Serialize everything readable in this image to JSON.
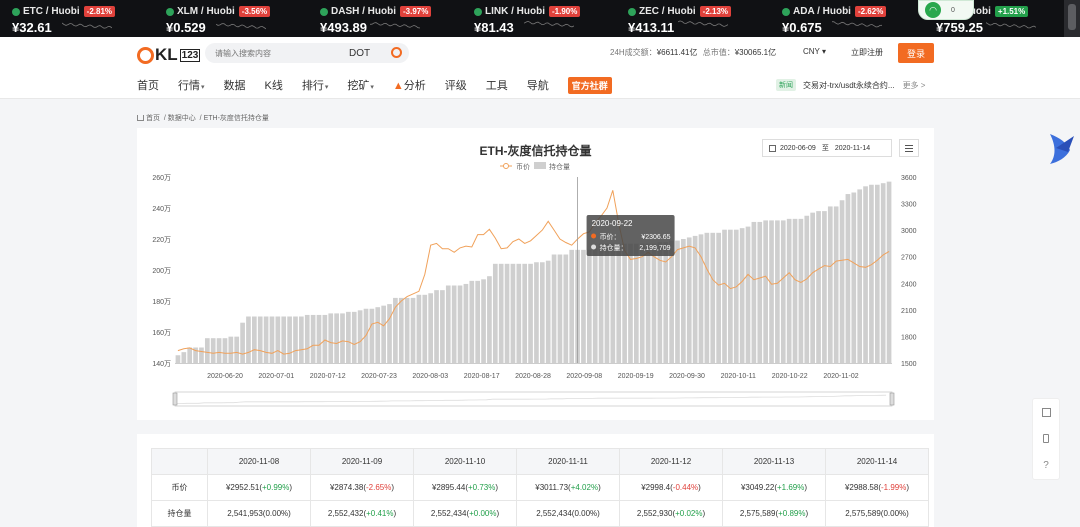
{
  "ticker": [
    {
      "pair": "ETC / Huobi",
      "change": "-2.81%",
      "dir": "neg",
      "price": "¥32.61"
    },
    {
      "pair": "XLM / Huobi",
      "change": "-3.56%",
      "dir": "neg",
      "price": "¥0.529"
    },
    {
      "pair": "DASH / Huobi",
      "change": "-3.97%",
      "dir": "neg",
      "price": "¥493.89"
    },
    {
      "pair": "LINK / Huobi",
      "change": "-1.90%",
      "dir": "neg",
      "price": "¥81.43"
    },
    {
      "pair": "ZEC / Huobi",
      "change": "-2.13%",
      "dir": "neg",
      "price": "¥413.11"
    },
    {
      "pair": "ADA / Huobi",
      "change": "-2.62%",
      "dir": "neg",
      "price": "¥0.675"
    },
    {
      "pair": "R / Huobi",
      "change": "+1.51%",
      "dir": "pos",
      "price": "¥759.25"
    }
  ],
  "wifi_badge": {
    "count": "0"
  },
  "header": {
    "logo_text": "KL",
    "logo_sub": "123",
    "search_placeholder": "请输入搜索内容",
    "search_tag": "DOT",
    "stats": {
      "volume_label": "24H成交额：",
      "volume": "¥6611.41亿",
      "cap_label": "总市值：",
      "cap": "¥30065.1亿"
    },
    "currency": "CNY ▾",
    "register": "立即注册",
    "login": "登录"
  },
  "nav": {
    "items": [
      "首页",
      "行情",
      "数据",
      "K线",
      "排行",
      "挖矿",
      "分析",
      "评级",
      "工具",
      "导航"
    ],
    "brand": "官方社群",
    "news_badge": "新闻",
    "news_text": "交易对-trx/usdt永续合约...",
    "more": "更多 >"
  },
  "breadcrumb": {
    "home": "首页",
    "data": "数据中心",
    "page": "ETH-灰度信托持仓量"
  },
  "chart_header": {
    "title": "ETH-灰度信托持仓量",
    "date_start": "2020-06-09",
    "date_sep": "至",
    "date_end": "2020-11-14"
  },
  "tooltip": {
    "date": "2020-09-22",
    "price_label": "币价：",
    "price": "¥2306.65",
    "hold_label": "持仓量：",
    "hold": "2,199,709"
  },
  "chart_data": {
    "type": "bar",
    "title": "ETH-灰度信托持仓量",
    "legend": [
      "币价",
      "持仓量"
    ],
    "legend_position": "top-center",
    "x_tick_labels": [
      "2020-06-20",
      "2020-07-01",
      "2020-07-12",
      "2020-07-23",
      "2020-08-03",
      "2020-08-17",
      "2020-08-28",
      "2020-09-08",
      "2020-09-19",
      "2020-09-30",
      "2020-10-11",
      "2020-10-22",
      "2020-11-02"
    ],
    "y_left": {
      "ticks": [
        "140万",
        "160万",
        "180万",
        "200万",
        "220万",
        "240万",
        "260万"
      ],
      "range": [
        140,
        260
      ],
      "unit": "万"
    },
    "y_right": {
      "ticks": [
        "1500",
        "1800",
        "2100",
        "2400",
        "2700",
        "3000",
        "3300",
        "3600"
      ],
      "range": [
        1500,
        3600
      ]
    },
    "holdings_wan": [
      145,
      147,
      150,
      150,
      150,
      156,
      156,
      156,
      156,
      157,
      157,
      166,
      170,
      170,
      170,
      170,
      170,
      170,
      170,
      170,
      170,
      170,
      171,
      171,
      171,
      171,
      172,
      172,
      172,
      173,
      173,
      174,
      175,
      175,
      176,
      177,
      178,
      182,
      182,
      182,
      182,
      184,
      184,
      185,
      187,
      187,
      190,
      190,
      190,
      191,
      193,
      193,
      194,
      196,
      204,
      204,
      204,
      204,
      204,
      204,
      204,
      205,
      205,
      206,
      210,
      210,
      210,
      213,
      213,
      213,
      213,
      214,
      217,
      217,
      217,
      217,
      217,
      217,
      217,
      217,
      217,
      217,
      218,
      218,
      219,
      219,
      220,
      221,
      222,
      223,
      224,
      224,
      224,
      226,
      226,
      226,
      227,
      228,
      231,
      231,
      232,
      232,
      232,
      232,
      233,
      233,
      233,
      235,
      237,
      238,
      238,
      241,
      241,
      245,
      249,
      250,
      252,
      254,
      255,
      255,
      256,
      257
    ],
    "price": [
      1640,
      1660,
      1670,
      1640,
      1630,
      1620,
      1610,
      1620,
      1610,
      1610,
      1620,
      1600,
      1620,
      1650,
      1640,
      1620,
      1610,
      1640,
      1600,
      1610,
      1640,
      1650,
      1660,
      1700,
      1700,
      1760,
      1730,
      1720,
      1750,
      1740,
      1710,
      1740,
      1810,
      1940,
      1960,
      1920,
      2000,
      2130,
      2200,
      2250,
      2280,
      2310,
      2500,
      2830,
      2850,
      2790,
      2790,
      2750,
      2800,
      2820,
      2810,
      2950,
      2950,
      3010,
      2910,
      2790,
      2800,
      2870,
      2900,
      2850,
      2880,
      2940,
      3000,
      3100,
      3000,
      2900,
      2860,
      2830,
      2900,
      2960,
      2980,
      3080,
      3160,
      3250,
      3450,
      3080,
      2770,
      2670,
      2680,
      2700,
      2750,
      2700,
      2660,
      2640,
      2700,
      2780,
      2800,
      2820,
      2800,
      2700,
      2560,
      2440,
      2380,
      2400,
      2340,
      2360,
      2420,
      2500,
      2440,
      2460,
      2480,
      2390,
      2400,
      2460,
      2520,
      2440,
      2410,
      2450,
      2520,
      2560,
      2600,
      2590,
      2650,
      2660,
      2670,
      2630,
      2590,
      2580,
      2610,
      2660,
      2720,
      2760
    ],
    "grid": false
  },
  "table": {
    "label_col": "",
    "dates": [
      "2020-11-08",
      "2020-11-09",
      "2020-11-10",
      "2020-11-11",
      "2020-11-12",
      "2020-11-13",
      "2020-11-14"
    ],
    "price_label": "币价",
    "hold_label": "持仓量",
    "price_rows": [
      {
        "v": "¥2952.51",
        "c": "+0.99%",
        "d": "up"
      },
      {
        "v": "¥2874.38",
        "c": "-2.65%",
        "d": "down"
      },
      {
        "v": "¥2895.44",
        "c": "+0.73%",
        "d": "up"
      },
      {
        "v": "¥3011.73",
        "c": "+4.02%",
        "d": "up"
      },
      {
        "v": "¥2998.4",
        "c": "-0.44%",
        "d": "down"
      },
      {
        "v": "¥3049.22",
        "c": "+1.69%",
        "d": "up"
      },
      {
        "v": "¥2988.58",
        "c": "-1.99%",
        "d": "down"
      }
    ],
    "hold_rows": [
      {
        "v": "2,541,953",
        "c": "0.00%",
        "d": ""
      },
      {
        "v": "2,552,432",
        "c": "+0.41%",
        "d": "up"
      },
      {
        "v": "2,552,434",
        "c": "+0.00%",
        "d": "up"
      },
      {
        "v": "2,552,434",
        "c": "0.00%",
        "d": ""
      },
      {
        "v": "2,552,930",
        "c": "+0.02%",
        "d": "up"
      },
      {
        "v": "2,575,589",
        "c": "+0.89%",
        "d": "up"
      },
      {
        "v": "2,575,589",
        "c": "0.00%",
        "d": ""
      }
    ]
  },
  "colors": {
    "accent": "#f26b22",
    "bar": "#cfcfcf",
    "line": "#f0a15a",
    "up": "#23a04b",
    "down": "#e0413b",
    "ticker_bg": "#101114"
  }
}
